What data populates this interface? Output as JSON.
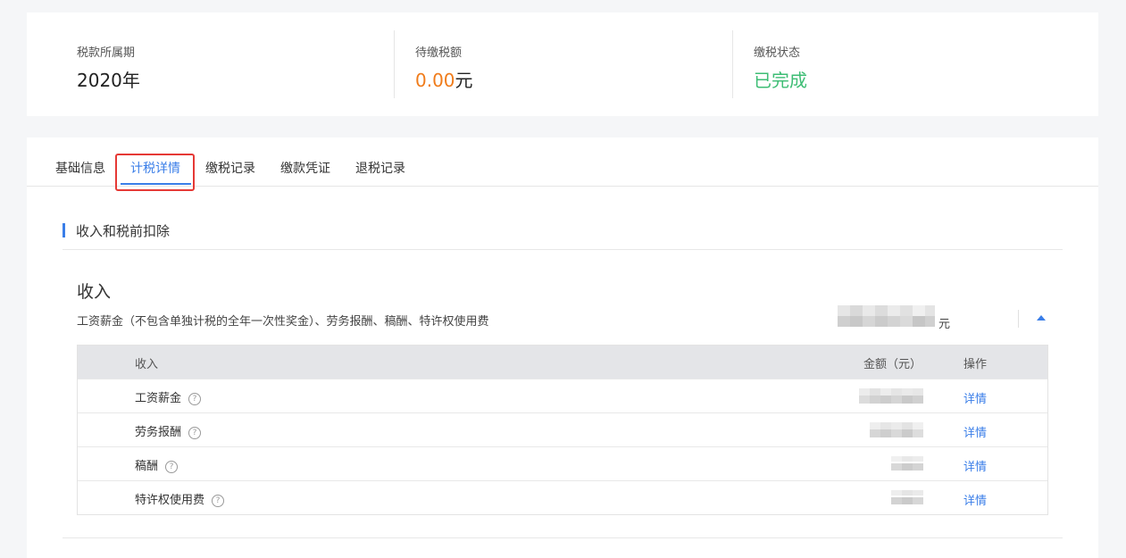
{
  "summary": {
    "period": {
      "label": "税款所属期",
      "value": "2020年"
    },
    "pending": {
      "label": "待缴税额",
      "amount": "0.00",
      "unit": "元"
    },
    "status": {
      "label": "缴税状态",
      "value": "已完成"
    }
  },
  "tabs": [
    {
      "label": "基础信息",
      "active": false
    },
    {
      "label": "计税详情",
      "active": true
    },
    {
      "label": "缴税记录",
      "active": false
    },
    {
      "label": "缴款凭证",
      "active": false
    },
    {
      "label": "退税记录",
      "active": false
    }
  ],
  "section": {
    "title": "收入和税前扣除"
  },
  "income": {
    "title": "收入",
    "description": "工资薪金（不包含单独计税的全年一次性奖金）、劳务报酬、稿酬、特许权使用费",
    "total_unit": "元",
    "table": {
      "headers": {
        "income": "收入",
        "amount": "金额（元）",
        "op": "操作"
      },
      "rows": [
        {
          "name": "工资薪金",
          "action": "详情"
        },
        {
          "name": "劳务报酬",
          "action": "详情"
        },
        {
          "name": "稿酬",
          "action": "详情"
        },
        {
          "name": "特许权使用费",
          "action": "详情"
        }
      ]
    }
  },
  "colors": {
    "accent": "#3a7ee8",
    "warning": "#f07c1b",
    "success": "#3dbd74",
    "highlight": "#e53935"
  },
  "icons": {
    "help": "question-circle-icon",
    "collapse": "caret-up-icon"
  }
}
